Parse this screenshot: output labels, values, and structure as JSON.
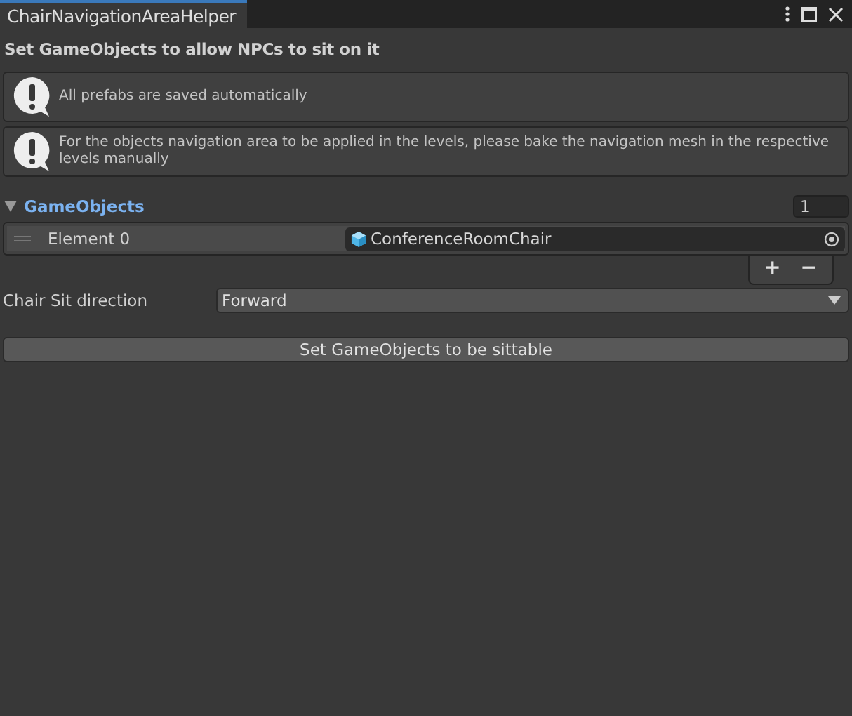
{
  "window": {
    "tab_title": "ChairNavigationAreaHelper"
  },
  "heading": "Set GameObjects to allow NPCs to sit on it",
  "help_boxes": [
    "All prefabs are saved automatically",
    "For the objects navigation area to be applied in the levels, please bake the navigation mesh in the respective levels manually"
  ],
  "list": {
    "label": "GameObjects",
    "expanded": true,
    "size": "1",
    "elements": [
      {
        "label": "Element 0",
        "value": "ConferenceRoomChair"
      }
    ],
    "add": "+",
    "remove": "−"
  },
  "direction": {
    "label": "Chair Sit direction",
    "value": "Forward"
  },
  "action_button": "Set GameObjects to be sittable"
}
